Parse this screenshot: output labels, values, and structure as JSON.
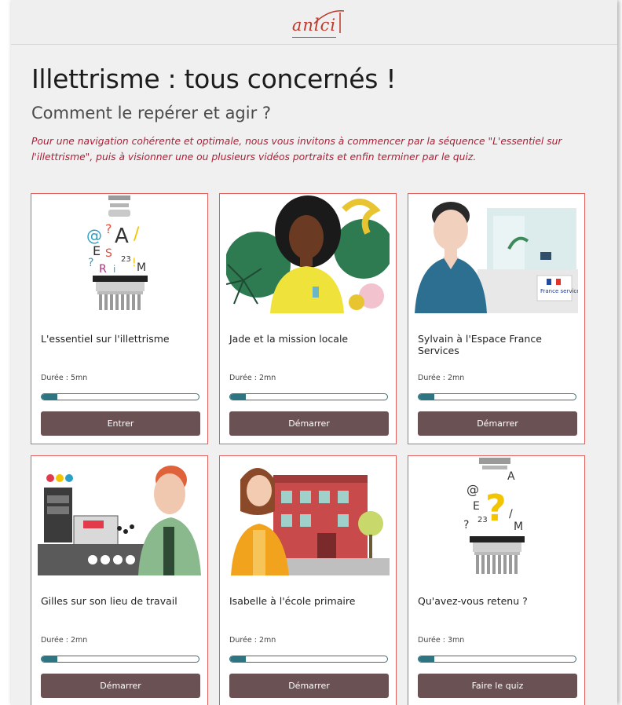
{
  "header": {
    "logo_text": "anlci"
  },
  "page": {
    "title": "Illettrisme : tous concernés !",
    "subtitle": "Comment le repérer et agir ?",
    "intro": "Pour une navigation cohérente et optimale, nous vous invitons à commencer par la séquence \"L'essentiel sur l'illettrisme\", puis à visionner une ou plusieurs vidéos portraits et enfin terminer par le quiz."
  },
  "cards": [
    {
      "title": "L'essentiel sur l'illettrisme",
      "duration": "Durée : 5mn",
      "progress": 0.1,
      "button": "Entrer",
      "image": "letters-machine-illustration"
    },
    {
      "title": "Jade et la mission locale",
      "duration": "Durée : 2mn",
      "progress": 0.1,
      "button": "Démarrer",
      "image": "jade-portrait-illustration"
    },
    {
      "title": "Sylvain à l'Espace France Services",
      "duration": "Durée : 2mn",
      "progress": 0.1,
      "button": "Démarrer",
      "image": "sylvain-france-services-illustration",
      "badge": "France services"
    },
    {
      "title": "Gilles sur son lieu de travail",
      "duration": "Durée : 2mn",
      "progress": 0.1,
      "button": "Démarrer",
      "image": "gilles-factory-illustration"
    },
    {
      "title": "Isabelle à l'école primaire",
      "duration": "Durée : 2mn",
      "progress": 0.1,
      "button": "Démarrer",
      "image": "isabelle-school-illustration"
    },
    {
      "title": "Qu'avez-vous retenu ?",
      "duration": "Durée : 3mn",
      "progress": 0.1,
      "button": "Faire le quiz",
      "image": "quiz-machine-illustration"
    }
  ],
  "colors": {
    "accent_red": "#b01b34",
    "card_border": "#e06060",
    "progress": "#2f7581",
    "button_bg": "#6a5254"
  }
}
